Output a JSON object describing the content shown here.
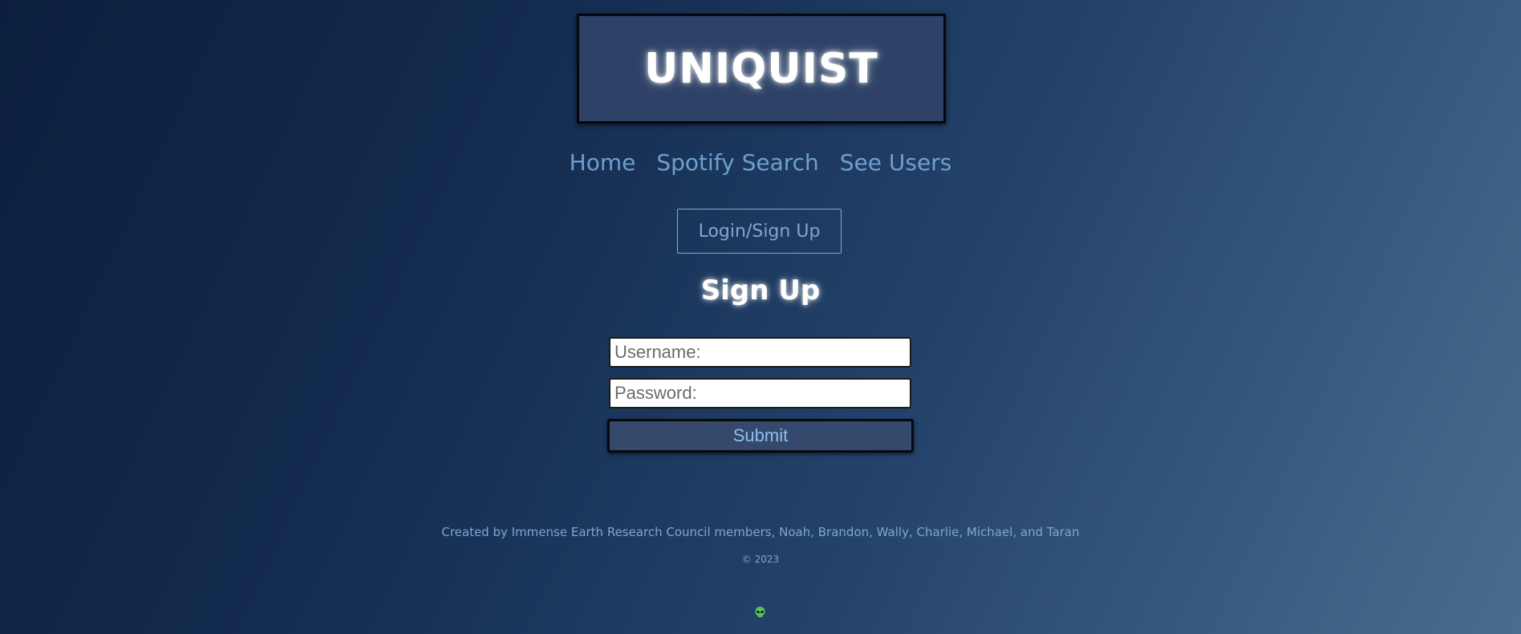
{
  "header": {
    "logo_text": "UNIQUIST"
  },
  "nav": {
    "items": [
      {
        "label": "Home"
      },
      {
        "label": "Spotify Search"
      },
      {
        "label": "See Users"
      }
    ]
  },
  "auth": {
    "login_signup_label": "Login/Sign Up"
  },
  "form": {
    "heading": "Sign Up",
    "username_placeholder": "Username:",
    "username_value": "",
    "password_placeholder": "Password:",
    "password_value": "",
    "submit_label": "Submit"
  },
  "footer": {
    "credit": "Created by Immense Earth Research Council members, Noah, Brandon, Wally, Charlie, Michael, and Taran",
    "copyright": "© 2023",
    "icon": "alien-icon"
  },
  "colors": {
    "accent": "#7fa6cf",
    "logo_box": "#2d4266",
    "submit_bg": "#34496b",
    "alien_green": "#5cc35a"
  }
}
